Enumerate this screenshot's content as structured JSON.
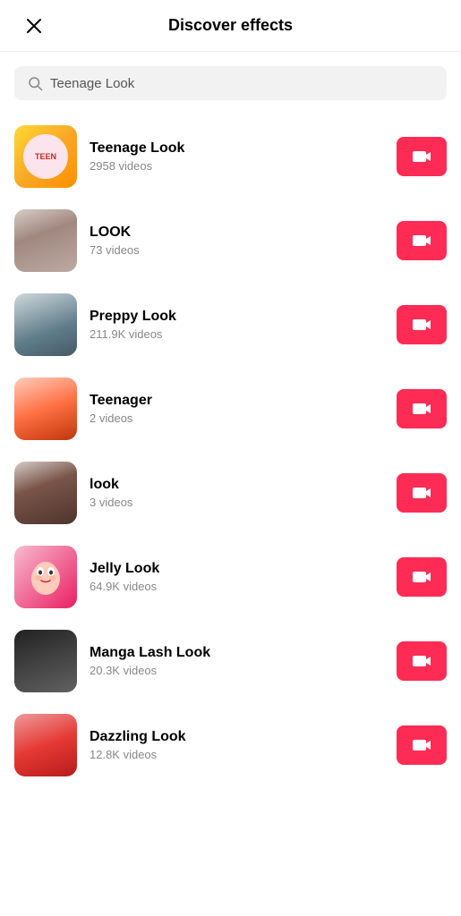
{
  "header": {
    "title": "Discover effects",
    "close_label": "×"
  },
  "search": {
    "placeholder": "Teenage Look",
    "value": "Teenage Look"
  },
  "effects": [
    {
      "id": "teenage-look",
      "name": "Teenage Look",
      "count": "2958 videos",
      "thumb_type": "teen"
    },
    {
      "id": "look",
      "name": "LOOK",
      "count": "73 videos",
      "thumb_type": "look"
    },
    {
      "id": "preppy-look",
      "name": "Preppy Look",
      "count": "211.9K videos",
      "thumb_type": "preppy"
    },
    {
      "id": "teenager",
      "name": "Teenager",
      "count": "2 videos",
      "thumb_type": "teenager"
    },
    {
      "id": "look2",
      "name": "look",
      "count": "3 videos",
      "thumb_type": "look2"
    },
    {
      "id": "jelly-look",
      "name": "Jelly Look",
      "count": "64.9K videos",
      "thumb_type": "jelly"
    },
    {
      "id": "manga-lash-look",
      "name": "Manga Lash Look",
      "count": "20.3K videos",
      "thumb_type": "manga"
    },
    {
      "id": "dazzling-look",
      "name": "Dazzling Look",
      "count": "12.8K videos",
      "thumb_type": "dazzling"
    }
  ],
  "record_button_label": "Record",
  "colors": {
    "accent": "#fe2c55"
  }
}
